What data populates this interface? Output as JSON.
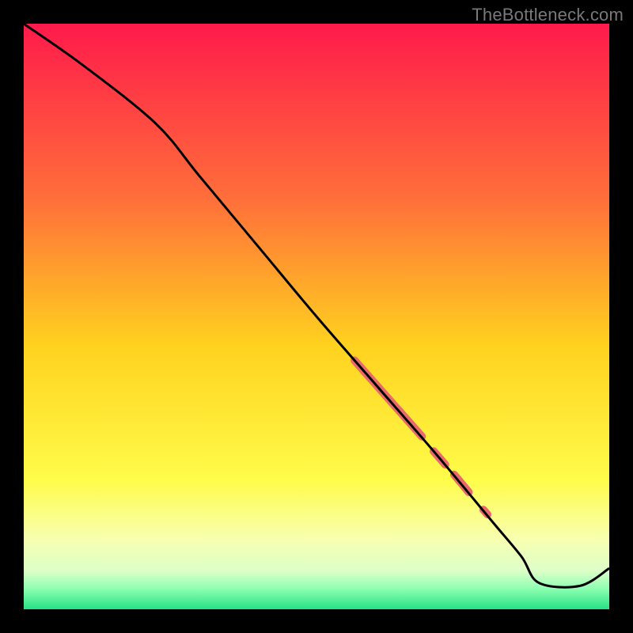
{
  "watermark": "TheBottleneck.com",
  "chart_data": {
    "type": "line",
    "title": "",
    "xlabel": "",
    "ylabel": "",
    "xlim": [
      0,
      100
    ],
    "ylim": [
      0,
      100
    ],
    "grid": false,
    "background_gradient": {
      "stops": [
        {
          "offset": 0.0,
          "color": "#ff1a4b"
        },
        {
          "offset": 0.3,
          "color": "#ff6f3a"
        },
        {
          "offset": 0.55,
          "color": "#ffd21f"
        },
        {
          "offset": 0.78,
          "color": "#fffc4a"
        },
        {
          "offset": 0.88,
          "color": "#f8ffb0"
        },
        {
          "offset": 0.935,
          "color": "#dcffc8"
        },
        {
          "offset": 0.965,
          "color": "#8dffb1"
        },
        {
          "offset": 1.0,
          "color": "#25e285"
        }
      ]
    },
    "series": [
      {
        "name": "curve",
        "color": "#000000",
        "x": [
          0.0,
          10.0,
          22.5,
          30.0,
          40.0,
          50.0,
          60.0,
          70.0,
          80.0,
          85.0,
          88.0,
          95.0,
          100.0
        ],
        "y": [
          100.0,
          93.0,
          83.0,
          74.0,
          62.0,
          50.0,
          38.5,
          27.0,
          15.0,
          9.0,
          4.5,
          4.0,
          7.0
        ]
      }
    ],
    "highlight": {
      "color": "#e96a6a",
      "segments": [
        {
          "x0": 56.5,
          "y0": 42.5,
          "x1": 68.0,
          "y1": 29.5,
          "w": 10
        },
        {
          "x0": 70.0,
          "y0": 27.0,
          "x1": 72.0,
          "y1": 24.7,
          "w": 10
        },
        {
          "x0": 73.5,
          "y0": 23.0,
          "x1": 76.0,
          "y1": 20.0,
          "w": 10
        },
        {
          "x0": 78.5,
          "y0": 17.0,
          "x1": 79.2,
          "y1": 16.2,
          "w": 10
        }
      ]
    }
  }
}
